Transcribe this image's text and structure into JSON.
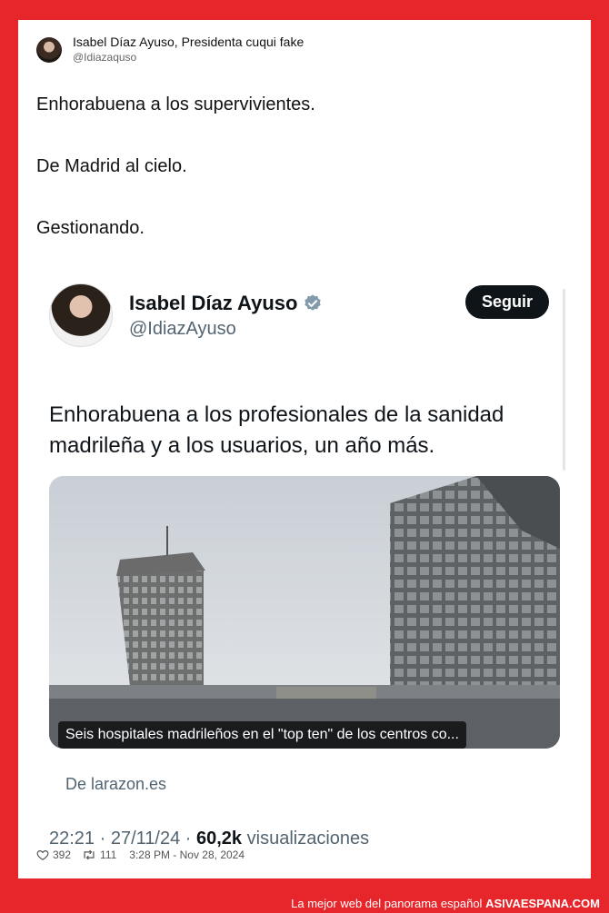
{
  "outer_tweet": {
    "author_name": "Isabel Díaz Ayuso, Presidenta cuqui fake",
    "author_handle": "@Idiazaquso",
    "lines": [
      "Enhorabuena a los supervivientes.",
      "De Madrid al cielo.",
      "Gestionando."
    ],
    "likes": "392",
    "retweets": "111",
    "timestamp": "3:28 PM - Nov 28, 2024"
  },
  "quoted_tweet": {
    "author_name": "Isabel Díaz Ayuso",
    "author_handle": "@IdiazAyuso",
    "follow_label": "Seguir",
    "text": "Enhorabuena a los profesionales de la sanidad madrileña y a los usuarios, un año más.",
    "card_caption": "Seis hospitales madrileños en el \"top ten\" de los centros co...",
    "card_source": "De larazon.es",
    "time": "22:21",
    "date": "27/11/24",
    "views_count": "60,2k",
    "views_label": "visualizaciones"
  },
  "footer": {
    "tagline": "La mejor web del panorama español",
    "site": "ASIVAESPANA.COM"
  },
  "colors": {
    "frame_red": "#e6262b",
    "verified_blue": "#829aab"
  }
}
